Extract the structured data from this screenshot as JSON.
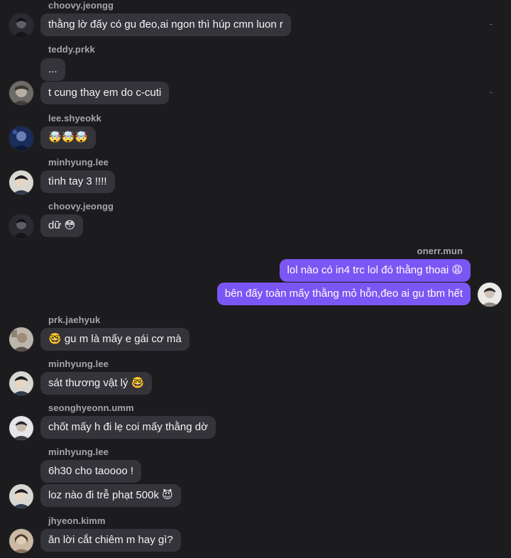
{
  "chat": {
    "messages": [
      {
        "sender": "choovy.jeongg",
        "text": "thằng lờ đấy có gu đeo,ai ngon thì húp cmn luon r"
      },
      {
        "sender": "teddy.prkk",
        "text": "..."
      },
      {
        "sender": "teddy.prkk",
        "text": "t cung thay em do c-cuti"
      },
      {
        "sender": "lee.shyeokk",
        "text": "🤯🤯🤯"
      },
      {
        "sender": "minhyung.lee",
        "text": "tình tay 3 !!!!"
      },
      {
        "sender": "choovy.jeongg",
        "text": "dữ 😳"
      },
      {
        "sender": "onerr.mun",
        "text": "lol nào có in4 trc lol đó thằng thoai 😩",
        "mine": true
      },
      {
        "sender": "onerr.mun",
        "text": "bên đấy toàn mấy thằng mỏ hỗn,đeo ai gu tbm hết",
        "mine": true
      },
      {
        "sender": "prk.jaehyuk",
        "text": "🤓 gu m là mấy e gái cơ mà"
      },
      {
        "sender": "minhyung.lee",
        "text": "sát thương vật lý 🤓"
      },
      {
        "sender": "seonghyeonn.umm",
        "text": "chốt mấy h đi lẹ coi mấy thằng dờ"
      },
      {
        "sender": "minhyung.lee",
        "text": "6h30 cho taoooo !"
      },
      {
        "sender": "minhyung.lee",
        "text": "loz nào đi trễ phạt 500k 😈"
      },
      {
        "sender": "jhyeon.kimm",
        "text": "ăn lời cắt chiêm m hay gì?"
      }
    ]
  },
  "colors": {
    "background": "#1c1c1f",
    "incoming_bubble": "#34343a",
    "outgoing_bubble": "#7c56f4",
    "username": "#a5a6ab"
  }
}
